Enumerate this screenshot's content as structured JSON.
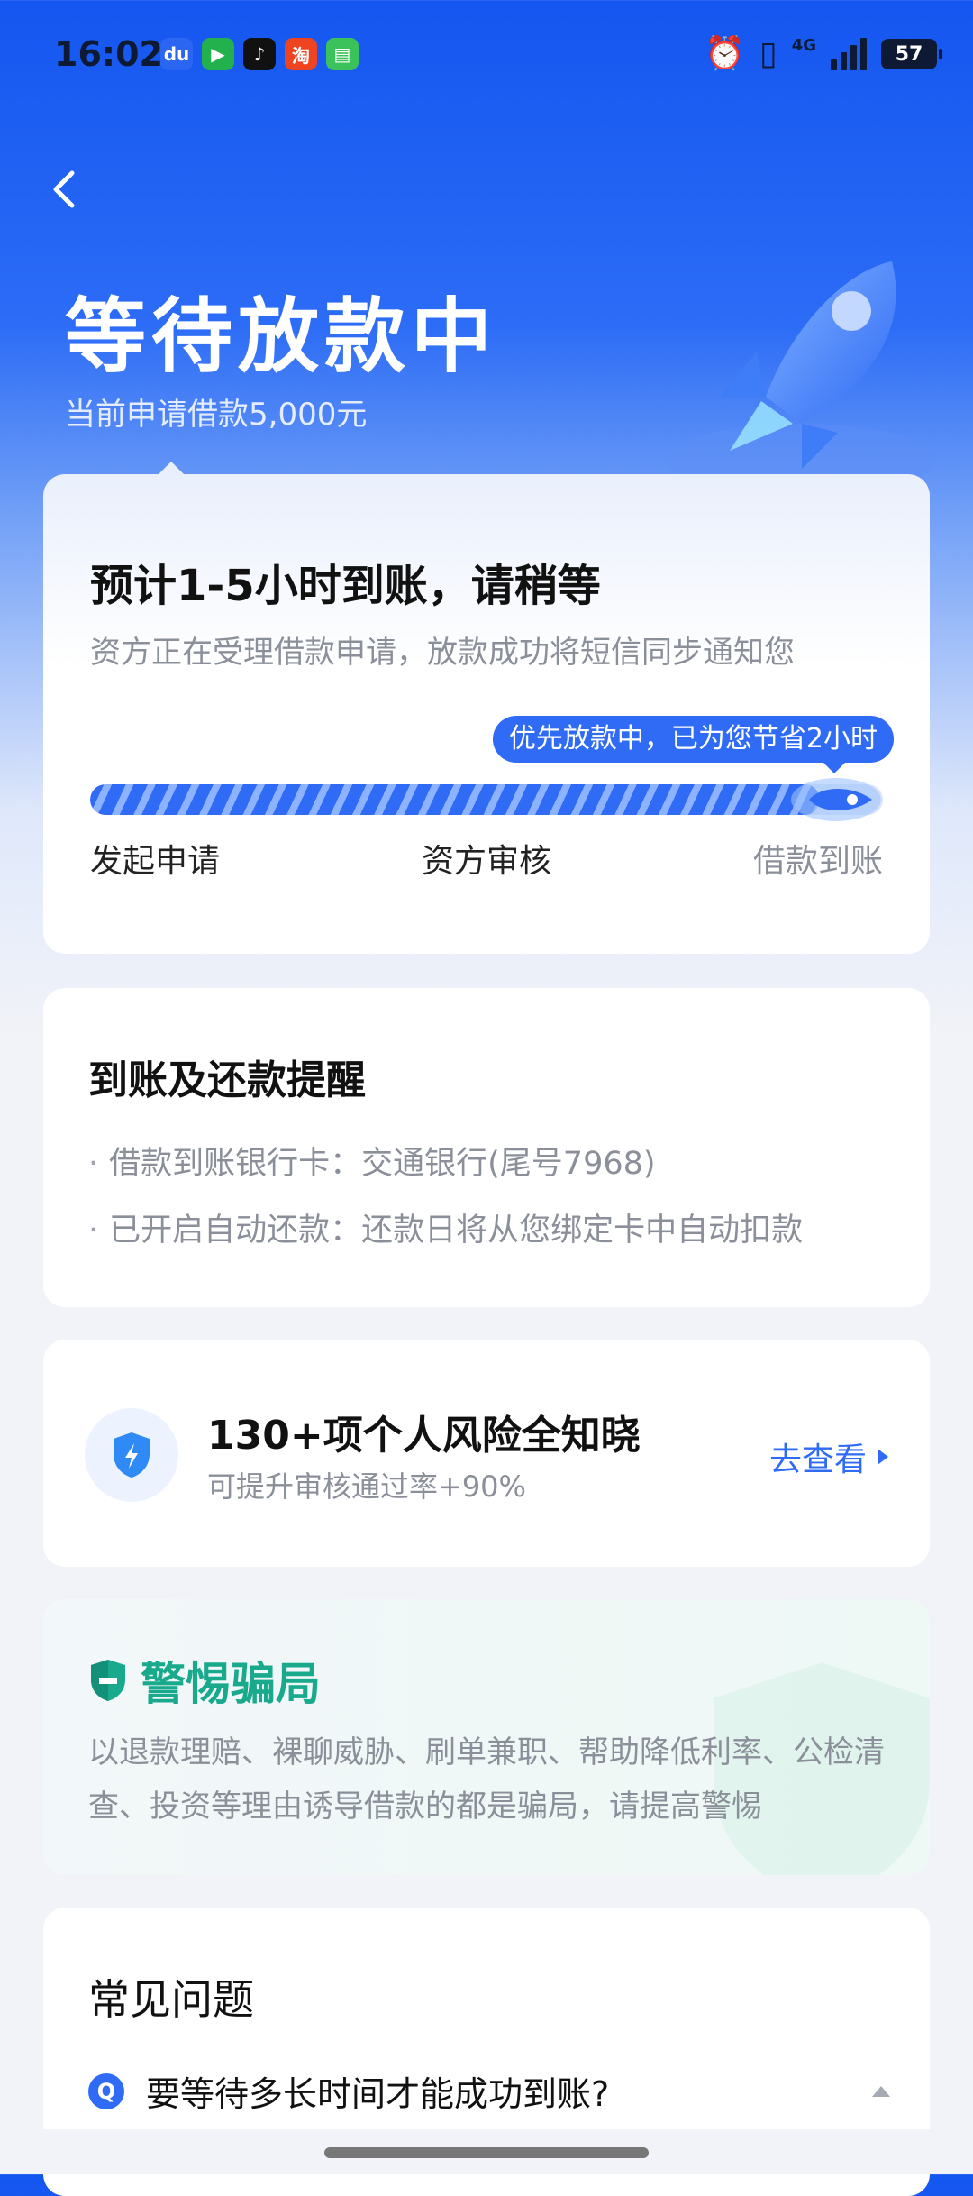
{
  "status_bar": {
    "time": "16:02",
    "apps": [
      "baidu-app",
      "iqiyi-app",
      "tiktok-app",
      "taobao-app",
      "messages-app"
    ],
    "network": "4G",
    "battery": "57"
  },
  "header": {
    "title": "等待放款中",
    "subtitle": "当前申请借款5,000元"
  },
  "status_card": {
    "title": "预计1-5小时到账，请稍等",
    "description": "资方正在受理借款申请，放款成功将短信同步通知您",
    "tip": "优先放款中，已为您节省2小时",
    "progress": 0.92,
    "steps": [
      "发起申请",
      "资方审核",
      "借款到账"
    ]
  },
  "remind_card": {
    "title": "到账及还款提醒",
    "items": [
      "借款到账银行卡：交通银行(尾号7968)",
      "已开启自动还款：还款日将从您绑定卡中自动扣款"
    ]
  },
  "risk_card": {
    "title": "130+项个人风险全知晓",
    "subtitle": "可提升审核通过率+90%",
    "link": "去查看"
  },
  "fraud_card": {
    "title": "警惕骗局",
    "text": "以退款理赔、裸聊威胁、刷单兼职、帮助降低利率、公检清查、投资等理由诱导借款的都是骗局，请提高警惕"
  },
  "faq_card": {
    "title": "常见问题",
    "badge": "Q",
    "question": "要等待多长时间才能成功到账?"
  },
  "colors": {
    "primary": "#2f6bf5",
    "header_blue": "#1456f0",
    "fraud_green": "#19a98c"
  }
}
